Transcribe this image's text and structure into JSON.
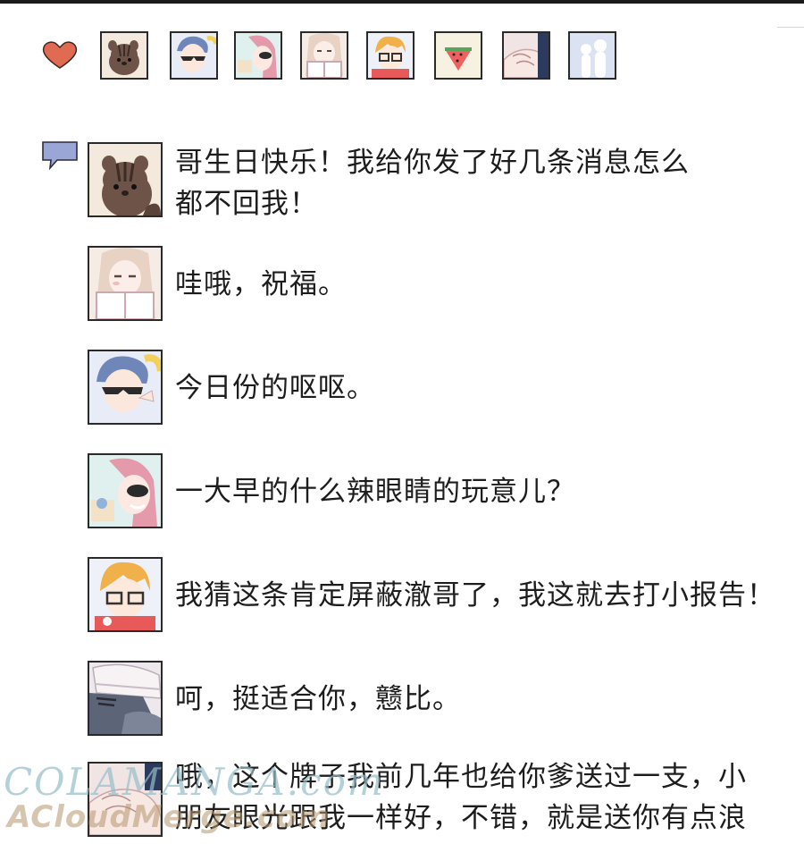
{
  "likes": {
    "avatars": [
      {
        "name": "squirrel-avatar",
        "bg": "#f3e9dc"
      },
      {
        "name": "sunglasses-boy-avatar",
        "bg": "#e7ecf6"
      },
      {
        "name": "pink-hair-avatar",
        "bg": "#f5e8ee"
      },
      {
        "name": "reading-girl-avatar",
        "bg": "#f6ece6"
      },
      {
        "name": "glasses-boy-avatar",
        "bg": "#eef1f8"
      },
      {
        "name": "watermelon-avatar",
        "bg": "#f7f1e2"
      },
      {
        "name": "hands-avatar",
        "bg": "#f1e4e4"
      },
      {
        "name": "couple-silhouette-avatar",
        "bg": "#dbe3f3"
      }
    ],
    "heart_color": "#e06a52"
  },
  "comments": [
    {
      "avatar": "squirrel-avatar",
      "text": "哥生日快乐！我给你发了好几条消息怎么\n都不回我！"
    },
    {
      "avatar": "reading-girl-avatar",
      "text": "哇哦，祝福。"
    },
    {
      "avatar": "sunglasses-boy-avatar",
      "text": "今日份的呕呕。"
    },
    {
      "avatar": "pink-hair-avatar",
      "text": "一大早的什么辣眼睛的玩意儿？"
    },
    {
      "avatar": "glasses-boy-avatar",
      "text": "我猜这条肯定屏蔽澈哥了，我这就去打小报告！"
    },
    {
      "avatar": "cap-boy-avatar",
      "text": "呵，挺适合你，戆比。"
    },
    {
      "avatar": "hands-avatar",
      "text": "哦，这个牌子我前几年也给你爹送过一支，小\n朋友眼光跟我一样好，不错，就是送你有点浪"
    }
  ],
  "watermark": {
    "line1": "COLAMANGA.com",
    "line2": "ACloudMerge.com"
  },
  "colors": {
    "border": "#2a2a2a",
    "comment_icon": "#9aa6d6"
  }
}
